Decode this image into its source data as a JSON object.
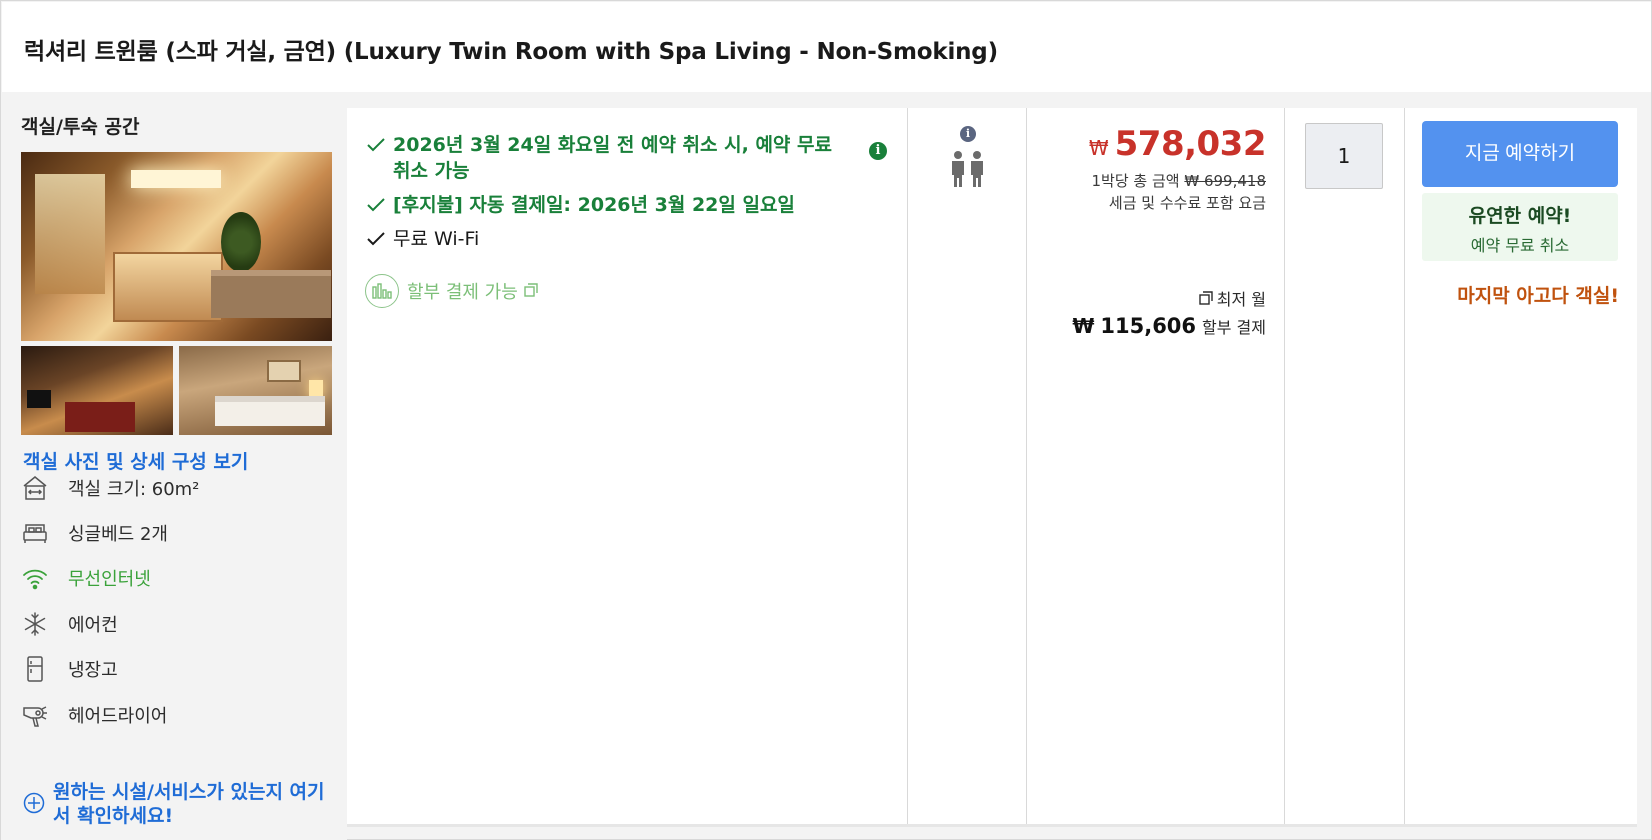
{
  "room": {
    "title": "럭셔리 트윈룸 (스파 거실, 금연) (Luxury Twin Room with Spa Living - Non-Smoking)"
  },
  "left": {
    "section_title": "객실/투숙 공간",
    "photos_link": "객실 사진 및 상세 구성 보기",
    "features": [
      {
        "icon": "room-size-icon",
        "label": "객실 크기: 60m²"
      },
      {
        "icon": "bed-icon",
        "label": "싱글베드 2개"
      },
      {
        "icon": "wifi-icon",
        "label": "무선인터넷",
        "color": "#3aa23a"
      },
      {
        "icon": "snowflake-icon",
        "label": "에어컨"
      },
      {
        "icon": "fridge-icon",
        "label": "냉장고"
      },
      {
        "icon": "hairdryer-icon",
        "label": "헤어드라이어"
      }
    ],
    "more_link": "원하는 시설/서비스가 있는지 여기서 확인하세요!"
  },
  "benefits": {
    "items": [
      {
        "text": "2026년 3월 24일 화요일 전 예약 취소 시, 예약 무료 취소 가능",
        "style": "green"
      },
      {
        "text": "[후지불] 자동 결제일: 2026년 3월 22일 일요일",
        "style": "green"
      },
      {
        "text": "무료 Wi-Fi",
        "style": "plain"
      }
    ],
    "installment": "할부 결제 가능"
  },
  "price": {
    "currency": "₩",
    "amount": "578,032",
    "total_line": "1박당 총 금액",
    "total_original": "₩ 699,418",
    "tax_note": "세금 및 수수료 포함 요금",
    "lowest_label": "최저 월",
    "installment_currency": "₩",
    "installment_amount": "115,606",
    "installment_label": "할부 결제"
  },
  "quantity": {
    "value": "1"
  },
  "booking": {
    "button_label": "지금 예약하기",
    "flex_title": "유연한 예약!",
    "flex_sub": "예약 무료 취소",
    "urgency": "마지막 아고다 객실!"
  },
  "colors": {
    "accent_blue": "#5392ef",
    "link_blue": "#1f6cd6",
    "price_red": "#c8322a",
    "benefit_green": "#19803a",
    "urgency_orange": "#c0520e"
  }
}
